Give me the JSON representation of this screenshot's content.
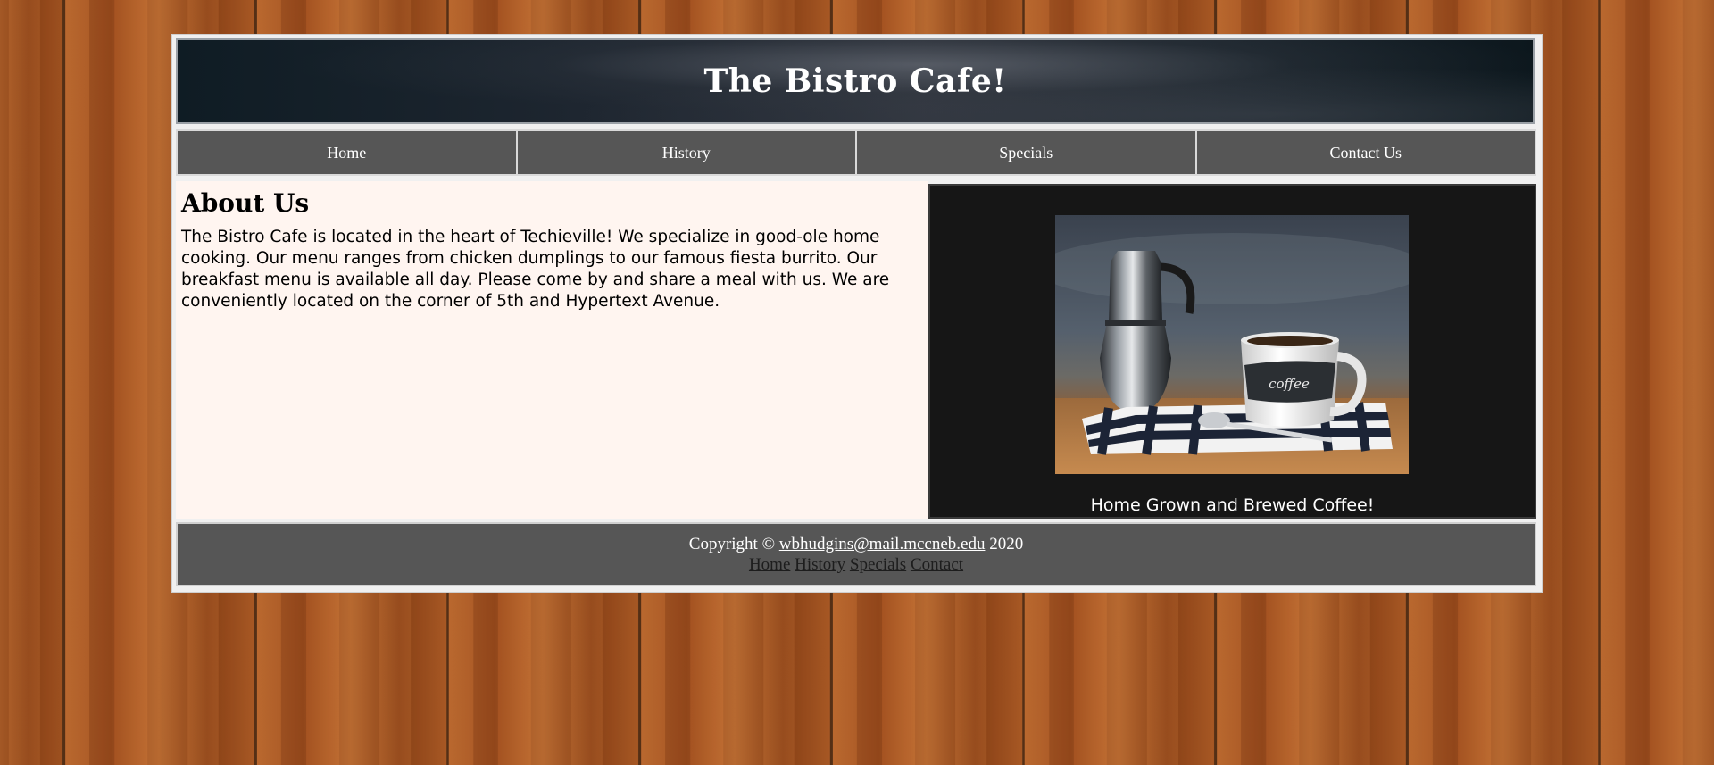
{
  "header": {
    "title": "The Bistro Cafe!"
  },
  "nav": {
    "items": [
      {
        "label": "Home"
      },
      {
        "label": "History"
      },
      {
        "label": "Specials"
      },
      {
        "label": "Contact Us"
      }
    ]
  },
  "about": {
    "heading": "About Us",
    "body": "The Bistro Cafe is located in the heart of Techieville! We specialize in good-ole home cooking. Our menu ranges from chicken dumplings to our famous fiesta burrito. Our breakfast menu is available all day. Please come by and share a meal with us. We are conveniently located on the corner of 5th and Hypertext Avenue."
  },
  "photo": {
    "mug_text": "coffee",
    "caption": "Home Grown and Brewed Coffee!"
  },
  "footer": {
    "copyright_prefix": "Copyright ©",
    "email": "wbhudgins@mail.mccneb.edu",
    "year": "2020",
    "links": [
      {
        "label": "Home"
      },
      {
        "label": "History"
      },
      {
        "label": "Specials"
      },
      {
        "label": "Contact"
      }
    ]
  }
}
